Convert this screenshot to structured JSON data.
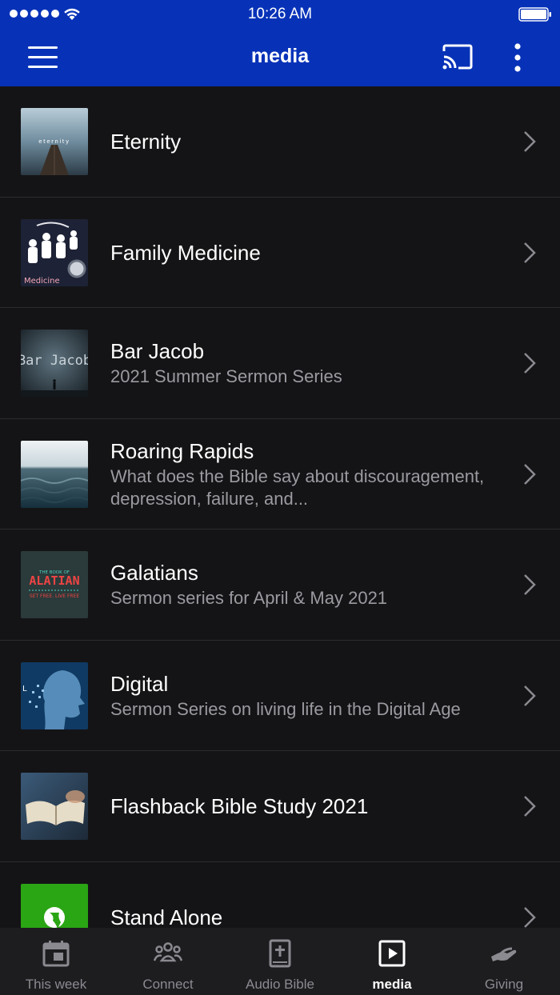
{
  "status_bar": {
    "time": "10:26 AM"
  },
  "header": {
    "title": "media"
  },
  "icons": {
    "menu": "hamburger-icon",
    "cast": "cast-icon",
    "more": "more-vertical-icon",
    "chevron": "chevron-right-icon"
  },
  "items": [
    {
      "title": "Eternity",
      "subtitle": "",
      "thumb_text": "eternity"
    },
    {
      "title": "Family Medicine",
      "subtitle": "",
      "thumb_text": "Medicine"
    },
    {
      "title": "Bar Jacob",
      "subtitle": "2021 Summer Sermon Series",
      "thumb_text": "Bar Jacob"
    },
    {
      "title": "Roaring Rapids",
      "subtitle": "What does the Bible say about discouragement, depression, failure, and...",
      "thumb_text": ""
    },
    {
      "title": "Galatians",
      "subtitle": "Sermon series for April & May 2021",
      "thumb_text": "ALATIAN"
    },
    {
      "title": "Digital",
      "subtitle": "Sermon Series on living life in the Digital Age",
      "thumb_text": ""
    },
    {
      "title": "Flashback Bible Study 2021",
      "subtitle": "",
      "thumb_text": ""
    },
    {
      "title": "Stand Alone",
      "subtitle": "",
      "thumb_text": ""
    }
  ],
  "tabs": [
    {
      "label": "This week",
      "icon": "calendar-icon",
      "active": false
    },
    {
      "label": "Connect",
      "icon": "people-icon",
      "active": false
    },
    {
      "label": "Audio Bible",
      "icon": "bible-icon",
      "active": false
    },
    {
      "label": "media",
      "icon": "play-icon",
      "active": true
    },
    {
      "label": "Giving",
      "icon": "giving-hand-icon",
      "active": false
    }
  ],
  "colors": {
    "header_bg": "#0732b8",
    "list_bg": "#141416",
    "tabbar_bg": "#1d1d20",
    "subtitle": "#9a9aa0",
    "inactive_tab": "#8a8a90"
  }
}
